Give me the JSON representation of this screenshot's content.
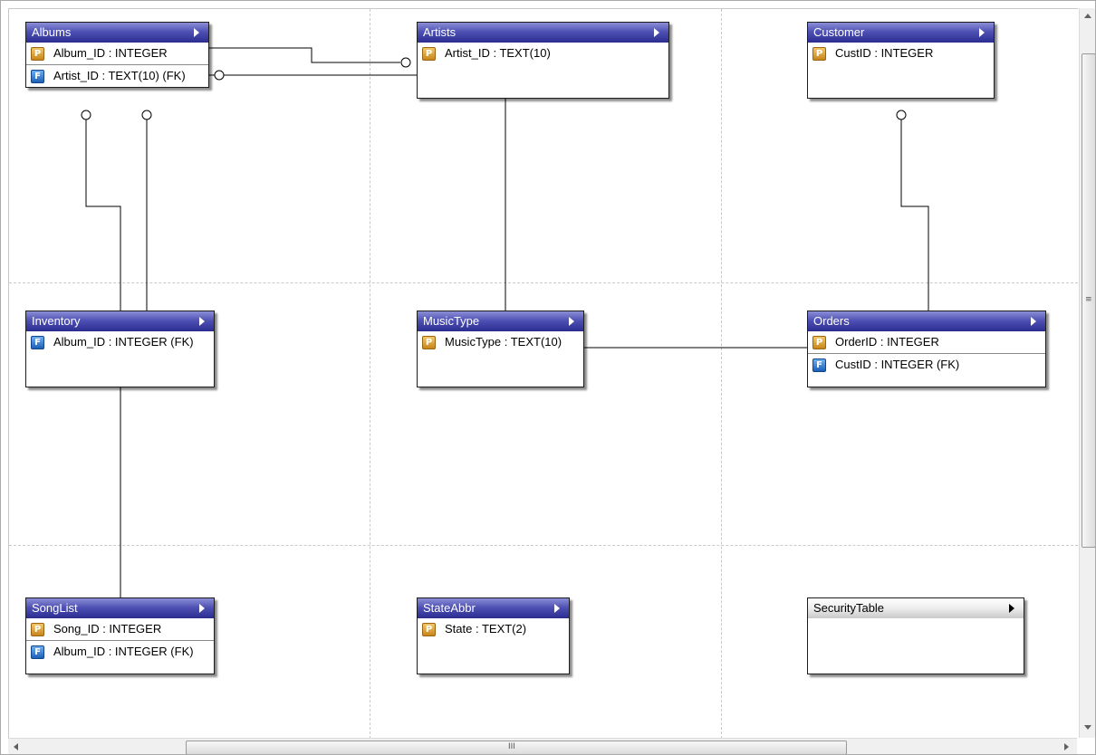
{
  "tables": [
    {
      "id": "albums",
      "name": "Albums",
      "style": "blue",
      "fields": [
        {
          "key": "P",
          "label": "Album_ID : INTEGER"
        },
        {
          "key": "F",
          "label": "Artist_ID : TEXT(10) (FK)"
        }
      ]
    },
    {
      "id": "artists",
      "name": "Artists",
      "style": "blue",
      "fields": [
        {
          "key": "P",
          "label": "Artist_ID : TEXT(10)"
        }
      ]
    },
    {
      "id": "customer",
      "name": "Customer",
      "style": "blue",
      "fields": [
        {
          "key": "P",
          "label": "CustID : INTEGER"
        }
      ]
    },
    {
      "id": "inventory",
      "name": "Inventory",
      "style": "blue",
      "fields": [
        {
          "key": "F",
          "label": "Album_ID : INTEGER (FK)"
        }
      ]
    },
    {
      "id": "musictype",
      "name": "MusicType",
      "style": "blue",
      "fields": [
        {
          "key": "P",
          "label": "MusicType : TEXT(10)"
        }
      ]
    },
    {
      "id": "orders",
      "name": "Orders",
      "style": "blue",
      "fields": [
        {
          "key": "P",
          "label": "OrderID : INTEGER"
        },
        {
          "key": "F",
          "label": "CustID : INTEGER (FK)"
        }
      ]
    },
    {
      "id": "songlist",
      "name": "SongList",
      "style": "blue",
      "fields": [
        {
          "key": "P",
          "label": "Song_ID : INTEGER"
        },
        {
          "key": "F",
          "label": "Album_ID : INTEGER (FK)"
        }
      ]
    },
    {
      "id": "stateabbr",
      "name": "StateAbbr",
      "style": "blue",
      "fields": [
        {
          "key": "P",
          "label": "State : TEXT(2)"
        }
      ]
    },
    {
      "id": "securitytable",
      "name": "SecurityTable",
      "style": "plain",
      "fields": []
    }
  ],
  "scrollbar": {
    "grip_v": "≡",
    "grip_h": "III"
  },
  "colors": {
    "header_blue": "#3a3da3",
    "primary_key": "#d9a23a",
    "foreign_key": "#2b74d4",
    "line": "#000000"
  }
}
